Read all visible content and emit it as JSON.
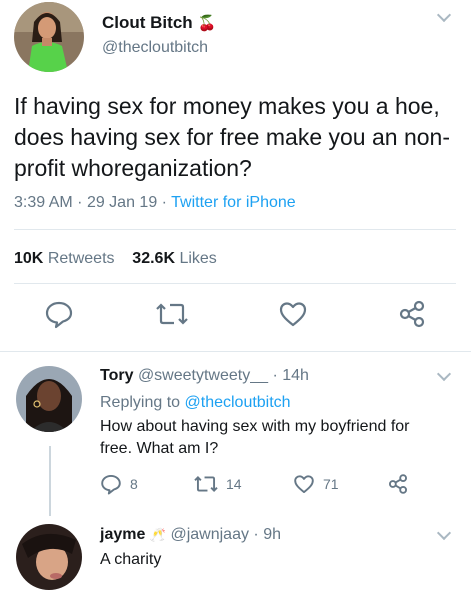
{
  "main_tweet": {
    "name": "Clout Bitch",
    "name_emoji": "🍒",
    "handle": "@thecloutbitch",
    "text": "If having sex for money makes you a hoe, does having sex for free make you an non-profit whoreganization?",
    "time": "3:39 AM",
    "date": "29 Jan 19",
    "separator": "·",
    "source": "Twitter for iPhone",
    "retweets_count": "10K",
    "retweets_label": "Retweets",
    "likes_count": "32.6K",
    "likes_label": "Likes"
  },
  "replies": [
    {
      "name": "Tory",
      "handle": "@sweetytweety__",
      "age": "· 14h",
      "replying_prefix": "Replying to",
      "replying_to": "@thecloutbitch",
      "text": "How about having sex with my boyfriend for free. What am I?",
      "reply_count": "8",
      "retweet_count": "14",
      "like_count": "71"
    },
    {
      "name": "jayme",
      "name_emoji": "🥂",
      "handle": "@jawnjaay",
      "age": "· 9h",
      "text": "A charity"
    }
  ],
  "icons": {
    "reply": "speech-bubble-icon",
    "retweet": "retweet-arrows-icon",
    "like": "heart-icon",
    "share": "share-nodes-icon",
    "menu": "chevron-down-icon"
  },
  "colors": {
    "link_blue": "#1da1f2",
    "secondary_text": "#657786",
    "icon_gray": "#657786"
  }
}
